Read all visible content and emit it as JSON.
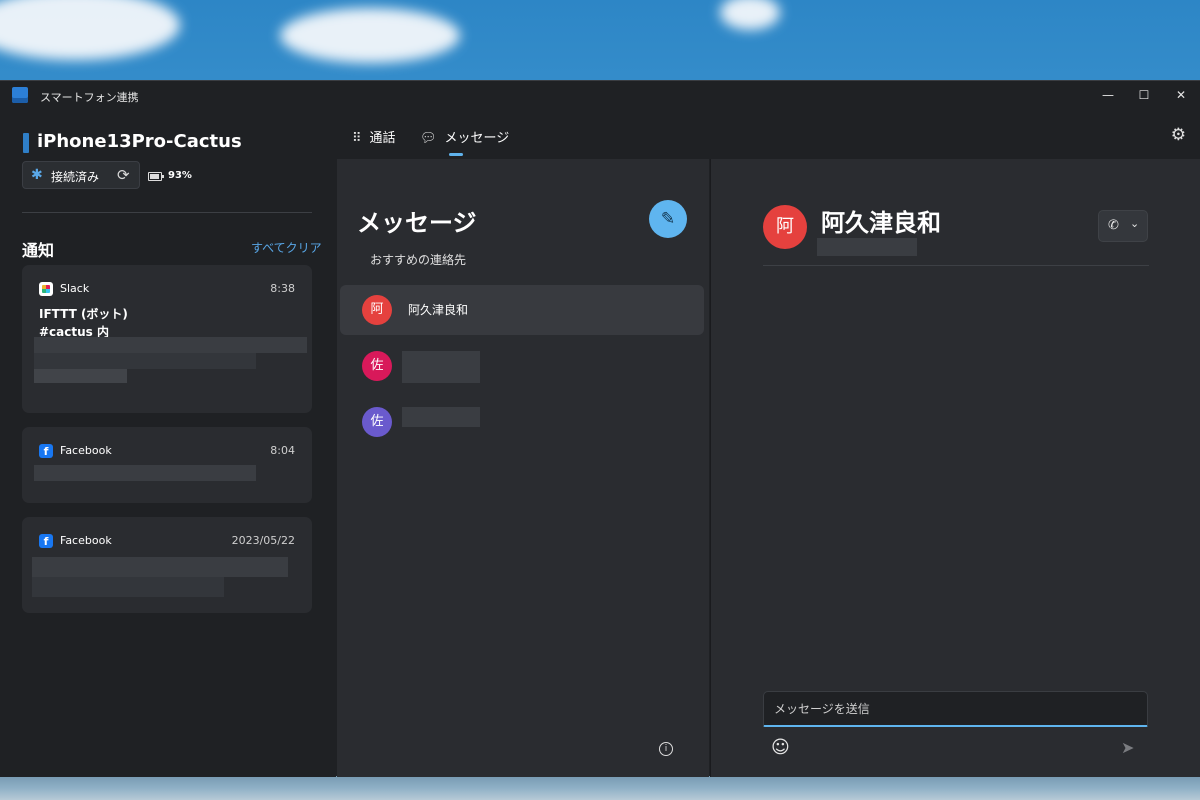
{
  "window": {
    "title": "スマートフォン連携"
  },
  "device": {
    "name": "iPhone13Pro-Cactus",
    "connection": "接続済み",
    "battery": "93%",
    "battery_level": 0.93
  },
  "notifications": {
    "title": "通知",
    "clear_all": "すべてクリア",
    "items": [
      {
        "app": "Slack",
        "time": "8:38",
        "line1": "IFTTT (ボット)",
        "line2": "#cactus 内"
      },
      {
        "app": "Facebook",
        "time": "8:04"
      },
      {
        "app": "Facebook",
        "time": "2023/05/22"
      }
    ]
  },
  "tabs": [
    {
      "label": "通話",
      "icon": "dialpad-icon"
    },
    {
      "label": "メッセージ",
      "icon": "chat-icon"
    }
  ],
  "messages": {
    "title": "メッセージ",
    "suggested_label": "おすすめの連絡先",
    "contacts": [
      {
        "avatar": "阿",
        "name": "阿久津良和",
        "color": "#e5413e"
      },
      {
        "avatar": "佐",
        "name": "",
        "color": "#d8195a"
      },
      {
        "avatar": "佐",
        "name": "",
        "color": "#6a5acd"
      }
    ]
  },
  "conversation": {
    "avatar": "阿",
    "name": "阿久津良和",
    "input_placeholder": "メッセージを送信"
  },
  "icons": {
    "app": "phone-link-icon",
    "bluetooth": "bluetooth-icon",
    "sync": "sync-icon",
    "battery": "battery-icon",
    "settings": "gear-icon",
    "compose": "compose-icon",
    "info": "info-icon",
    "call": "phone-icon",
    "emoji": "emoji-icon",
    "send": "send-icon"
  },
  "colors": {
    "accent": "#5fb5ef",
    "link": "#58a6e6",
    "panel": "#2a2c30",
    "sidebar": "#1f2124"
  }
}
